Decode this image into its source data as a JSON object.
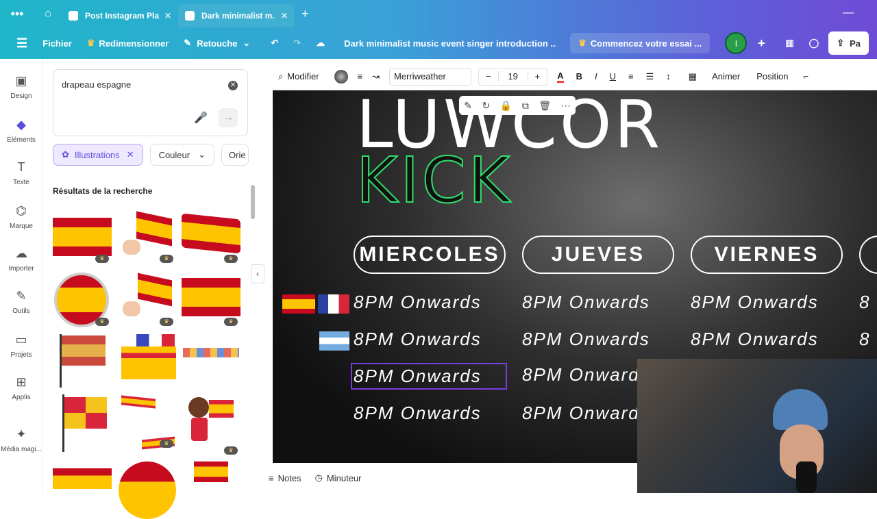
{
  "tabs": [
    {
      "label": "Post Instagram Pla..."
    },
    {
      "label": "Dark minimalist m..."
    }
  ],
  "toolbar": {
    "file": "Fichier",
    "resize": "Redimensionner",
    "retouch": "Retouche",
    "doc_title": "Dark minimalist music event singer introduction ...",
    "trial": "Commencez votre essai ...",
    "avatar_letter": "I",
    "share": "Pa"
  },
  "sidenav": {
    "items": [
      {
        "label": "Design",
        "icon": "design-icon"
      },
      {
        "label": "Éléments",
        "icon": "elements-icon"
      },
      {
        "label": "Texte",
        "icon": "text-icon"
      },
      {
        "label": "Marque",
        "icon": "brand-icon"
      },
      {
        "label": "Importer",
        "icon": "upload-icon"
      },
      {
        "label": "Outils",
        "icon": "tools-icon"
      },
      {
        "label": "Projets",
        "icon": "folder-icon"
      },
      {
        "label": "Applis",
        "icon": "apps-icon"
      },
      {
        "label": "Média magi...",
        "icon": "magic-media-icon"
      }
    ]
  },
  "search": {
    "value": "drapeau espagne"
  },
  "chips": {
    "illustrations": "Illustrations",
    "color": "Couleur",
    "orientation": "Orie"
  },
  "results_title": "Résultats de la recherche",
  "editor": {
    "modify": "Modifier",
    "font": "Merriweather",
    "size": "19",
    "animate": "Animer",
    "position": "Position"
  },
  "canvas": {
    "title_line1": "LUWCOR",
    "title_line2": "KICK",
    "days": [
      "MIERCOLES",
      "JUEVES",
      "VIERNES"
    ],
    "time_label": "8PM Onwards"
  },
  "bottom": {
    "notes": "Notes",
    "timer": "Minuteur"
  },
  "colors": {
    "accent": "#5b4de0",
    "gradient_start": "#1fb6c9",
    "gradient_end": "#6f4bd6",
    "neon_green": "#2ee06a",
    "selection": "#7c3ce0"
  }
}
